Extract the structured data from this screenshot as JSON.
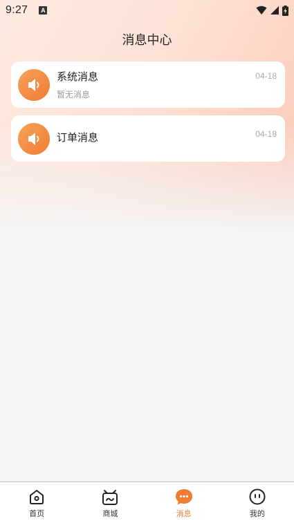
{
  "status_bar": {
    "time": "9:27",
    "badge": "A",
    "icons": [
      "wifi-icon",
      "signal-icon",
      "battery-charging-icon"
    ]
  },
  "header": {
    "title": "消息中心"
  },
  "messages": [
    {
      "title": "系统消息",
      "subtitle": "暂无消息",
      "date": "04-18",
      "icon": "speaker-icon"
    },
    {
      "title": "订单消息",
      "subtitle": "",
      "date": "04-18",
      "icon": "speaker-icon"
    }
  ],
  "tab_bar": {
    "active_color": "#f07b32",
    "tabs": [
      {
        "label": "首页",
        "icon": "home-icon",
        "active": false
      },
      {
        "label": "商城",
        "icon": "shop-icon",
        "active": false
      },
      {
        "label": "消息",
        "icon": "message-icon",
        "active": true
      },
      {
        "label": "我的",
        "icon": "profile-icon",
        "active": false
      }
    ]
  },
  "colors": {
    "accent": "#f07b32",
    "gradient_start": "#fdebe1",
    "gradient_end": "#fcc7b5"
  }
}
